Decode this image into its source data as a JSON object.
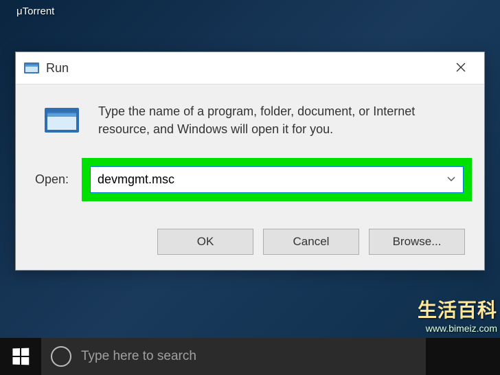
{
  "desktop": {
    "icon_label": "μTorrent"
  },
  "run_dialog": {
    "title": "Run",
    "instruction": "Type the name of a program, folder, document, or Internet resource, and Windows will open it for you.",
    "open_label": "Open:",
    "input_value": "devmgmt.msc",
    "buttons": {
      "ok": "OK",
      "cancel": "Cancel",
      "browse": "Browse..."
    }
  },
  "taskbar": {
    "search_placeholder": "Type here to search"
  },
  "watermark": {
    "line1": "生活百科",
    "line2": "www.bimeiz.com"
  }
}
